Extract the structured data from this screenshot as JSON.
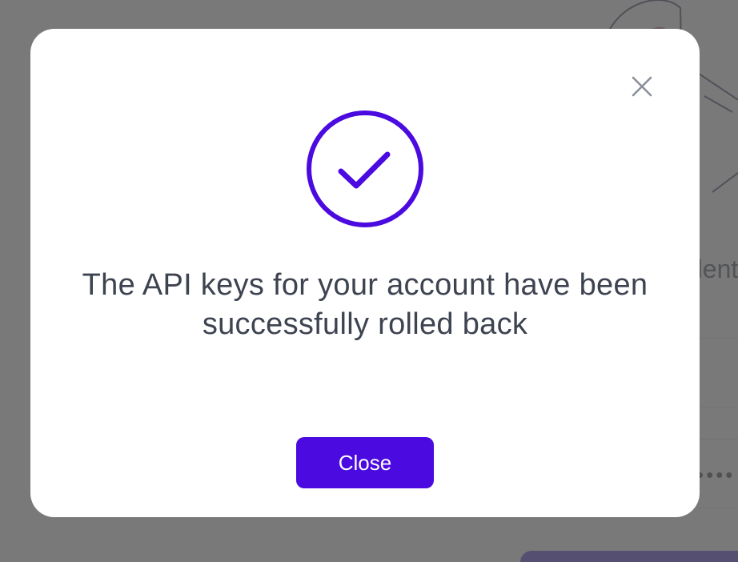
{
  "background": {
    "heading_fragment": "dent",
    "masked_value": "••••"
  },
  "modal": {
    "close_icon": "close-icon",
    "status_icon": "check-circle-icon",
    "message": "The API keys for your account have been successfully rolled back",
    "close_button_label": "Close"
  },
  "colors": {
    "accent": "#4a0ae0",
    "text": "#3d4350",
    "overlay": "#5c5c5c",
    "close_icon": "#8a8f99"
  }
}
